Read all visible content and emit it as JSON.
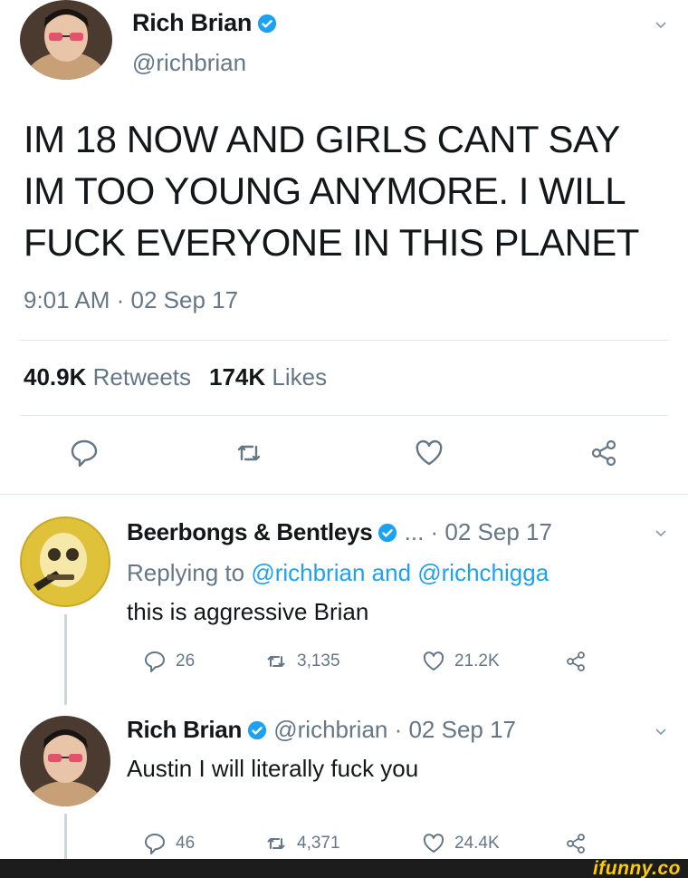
{
  "main_tweet": {
    "name": "Rich Brian",
    "handle": "@richbrian",
    "text_lines": [
      "IM 18 NOW AND GIRLS CANT SAY",
      "IM TOO YOUNG ANYMORE. I WILL",
      "FUCK EVERYONE IN THIS PLANET"
    ],
    "timestamp": "9:01 AM · 02 Sep 17",
    "retweet_count": "40.9K",
    "retweet_label": "Retweets",
    "like_count": "174K",
    "like_label": "Likes",
    "actions": [
      "reply-icon",
      "retweet-icon",
      "like-icon",
      "share-icon"
    ]
  },
  "replies": [
    {
      "name": "Beerbongs & Bentleys",
      "meta": " ... · 02 Sep 17",
      "replying_prefix": "Replying to ",
      "replying_to_1": "@richbrian",
      "replying_and": " and ",
      "replying_to_2": "@richchigga",
      "text": "this is aggressive Brian",
      "reply_count": "26",
      "retweet_count": "3,135",
      "like_count": "21.2K"
    },
    {
      "name": "Rich Brian",
      "meta": " @richbrian · 02 Sep 17",
      "text": "Austin I will literally fuck you",
      "reply_count": "46",
      "retweet_count": "4,371",
      "like_count": "24.4K"
    }
  ],
  "watermark": "ifunny.co",
  "colors": {
    "text": "#14171a",
    "secondary": "#657786",
    "accent": "#1da1f2",
    "divider": "#e1e8ed"
  }
}
